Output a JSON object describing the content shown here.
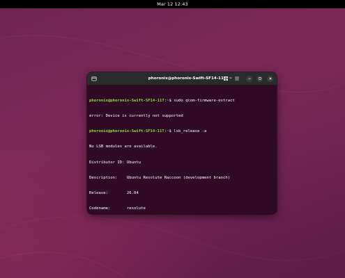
{
  "topbar": {
    "clock": "Mar 12  12:43"
  },
  "terminal": {
    "title": "phoronix@phoronix-Swift-SF14-11T: ~",
    "buttons": {
      "new_tab_icon": "new-tab-icon",
      "grid_icon": "grid-icon",
      "menu_icon": "hamburger-menu-icon",
      "minimize_icon": "minimize-icon",
      "maximize_icon": "maximize-icon",
      "close_icon": "close-icon"
    },
    "prompt": {
      "user_host": "phoronix@phoronix-Swift-SF14-11T",
      "sep": ":",
      "path": "~",
      "symbol": "$ "
    },
    "lines": [
      {
        "kind": "prompt",
        "command": "sudo qcom-firmware-extract"
      },
      {
        "kind": "output",
        "text": "error: Device is currently not supported"
      },
      {
        "kind": "prompt",
        "command": "lsb_release -a"
      },
      {
        "kind": "output",
        "text": "No LSB modules are available."
      },
      {
        "kind": "output",
        "text": "Distributor ID:\tUbuntu"
      },
      {
        "kind": "output",
        "text": "Description:\tUbuntu Resolute Raccoon (development branch)"
      },
      {
        "kind": "output",
        "text": "Release:\t26.04"
      },
      {
        "kind": "output",
        "text": "Codename:\tresolute"
      },
      {
        "kind": "prompt",
        "command": ""
      }
    ]
  },
  "colors": {
    "terminal_bg": "#300a24",
    "prompt_user": "#8ae234",
    "prompt_path": "#729fcf",
    "headerbar": "#2b2b2b",
    "topbar": "#000000"
  }
}
